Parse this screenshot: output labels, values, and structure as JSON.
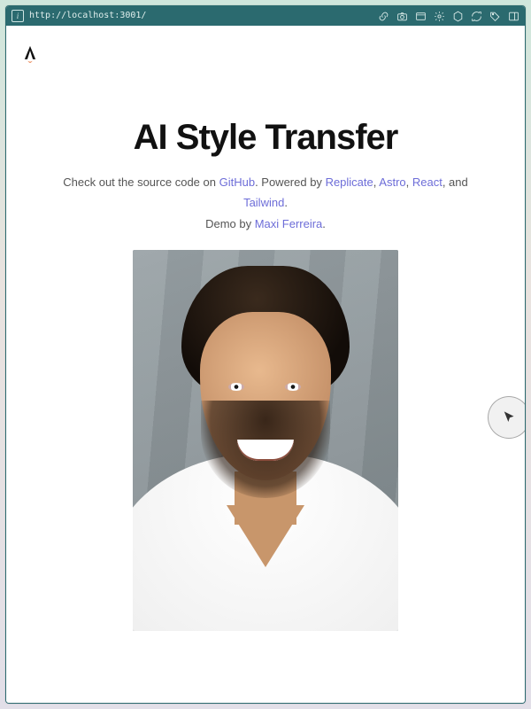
{
  "browser": {
    "url": "http://localhost:3001/",
    "toolbar_icons": [
      "link",
      "camera",
      "window",
      "gear",
      "hex",
      "sync",
      "tag",
      "panel"
    ]
  },
  "page": {
    "title": "AI Style Transfer",
    "subtitle": {
      "pre": "Check out the source code on ",
      "link_github": "GitHub",
      "mid1": ". Powered by ",
      "link_replicate": "Replicate",
      "sep1": ", ",
      "link_astro": "Astro",
      "sep2": ", ",
      "link_react": "React",
      "mid2": ", and ",
      "link_tailwind": "Tailwind",
      "end1": ".",
      "demo_pre": "Demo by ",
      "link_author": "Maxi Ferreira",
      "end2": "."
    },
    "logo_name": "astro-logo",
    "hero_alt": "portrait-photo",
    "fab_icon": "cursor-icon"
  }
}
